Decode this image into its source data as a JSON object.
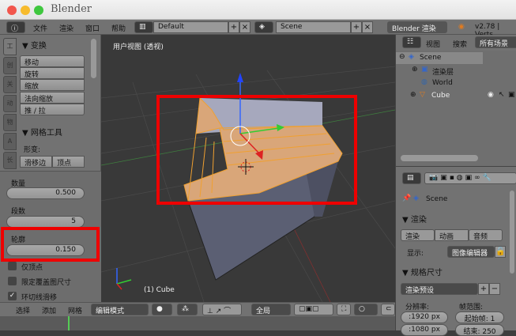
{
  "window": {
    "title": "Blender"
  },
  "menubar": {
    "items": [
      "文件",
      "渲染",
      "窗口",
      "帮助"
    ],
    "layout": "Default",
    "scene": "Scene",
    "engine": "Blender 渲染",
    "version": "v2.78 | Verts"
  },
  "toolpanel": {
    "tabs": [
      "工",
      "创",
      "关",
      "动",
      "物",
      "A",
      "长"
    ],
    "transform": {
      "title": "▼ 变换",
      "buttons": [
        "移动",
        "旋转",
        "缩放",
        "法向缩放",
        "推 / 拉"
      ]
    },
    "meshtools": {
      "title": "▼ 网格工具",
      "deform_label": "形变:",
      "buttons": [
        "滑移边",
        "顶点"
      ]
    },
    "operator": {
      "amount_label": "数量",
      "amount": "0.500",
      "segments_label": "段数",
      "segments": "5",
      "profile_label": "轮廓",
      "profile": "0.150",
      "options": [
        {
          "label": "仅顶点",
          "checked": false
        },
        {
          "label": "限定覆盖图尺寸",
          "checked": false
        },
        {
          "label": "环切线滑移",
          "checked": true
        }
      ]
    }
  },
  "viewport": {
    "label": "用户视图 (透视)",
    "object_label": "(1) Cube"
  },
  "bottombar": {
    "menus": [
      "选择",
      "添加",
      "网格"
    ],
    "mode": "编辑模式",
    "pivot": "全局"
  },
  "outliner": {
    "menus": [
      "视图",
      "搜索"
    ],
    "filter": "所有场景",
    "tree": [
      {
        "label": "Scene",
        "level": 0
      },
      {
        "label": "渲染层",
        "level": 1
      },
      {
        "label": "World",
        "level": 1
      },
      {
        "label": "Cube",
        "level": 1
      }
    ]
  },
  "properties": {
    "context": "Scene",
    "render": {
      "title": "▼ 渲染",
      "buttons": [
        "渲染",
        "动画",
        "音频"
      ],
      "display_label": "显示:",
      "display_value": "图像编辑器"
    },
    "dimensions": {
      "title": "▼ 规格尺寸",
      "preset": "渲染预设",
      "resolution_label": "分辨率:",
      "frame_range_label": "帧范围:",
      "res_x": ":1920 px",
      "res_y": ":1080 px",
      "start": "起始帧: 1",
      "end": "结束: 250"
    }
  },
  "colors": {
    "highlight": "#e00000",
    "selected": "#e8b07e"
  }
}
